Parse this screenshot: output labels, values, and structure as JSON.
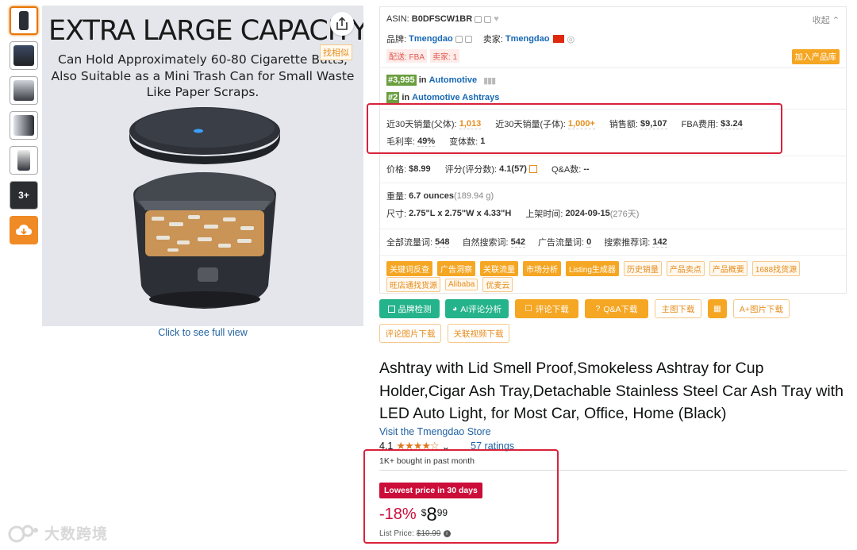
{
  "thumbnails": {
    "more_label": "3+"
  },
  "image": {
    "headline": "EXTRA LARGE CAPACITY",
    "subline_1": "Can Hold Approximately 60-80 Cigarette Butts,",
    "subline_2": "Also Suitable as a Mini Trash Can for Small Waste",
    "subline_3": "Like Paper Scraps.",
    "find_similar": "找相似",
    "click_full": "Click to see full view"
  },
  "watermark": {
    "text": "大数跨境"
  },
  "panel": {
    "asin_label": "ASIN:",
    "asin": "B0DFSCW1BR",
    "collapse": "收起",
    "brand_label": "品牌:",
    "brand": "Tmengdao",
    "seller_label": "卖家:",
    "seller": "Tmengdao",
    "tag_fba": "配送: FBA",
    "tag_seller": "卖家: 1",
    "add_library": "加入产品库",
    "rank1": "#3,995",
    "rank1_in": "in",
    "rank1_cat": "Automotive",
    "rank2": "#2",
    "rank2_in": "in",
    "rank2_cat": "Automotive Ashtrays",
    "sales30_parent_label": "近30天销量(父体):",
    "sales30_parent": "1,013",
    "sales30_child_label": "近30天销量(子体):",
    "sales30_child": "1,000+",
    "revenue_label": "销售额:",
    "revenue": "$9,107",
    "fba_label": "FBA费用:",
    "fba": "$3.24",
    "margin_label": "毛利率:",
    "margin": "49%",
    "variants_label": "变体数:",
    "variants": "1",
    "price_label": "价格:",
    "price": "$8.99",
    "score_label": "评分(评分数):",
    "score": "4.1(57)",
    "qa_label": "Q&A数:",
    "qa": "--",
    "weight_label": "重量:",
    "weight": "6.7 ounces",
    "weight_g": "(189.94 g)",
    "size_label": "尺寸:",
    "size": "2.75\"L x 2.75\"W x 4.33\"H",
    "listed_label": "上架时间:",
    "listed": "2024-09-15",
    "listed_days": "(276天)",
    "kw_all_label": "全部流量词:",
    "kw_all": "548",
    "kw_organic_label": "自然搜索词:",
    "kw_organic": "542",
    "kw_ad_label": "广告流量词:",
    "kw_ad": "0",
    "kw_rec_label": "搜索推荐词:",
    "kw_rec": "142",
    "chips_row1": [
      "关键词反查",
      "广告洞察",
      "关联流量",
      "市场分析",
      "Listing生成器",
      "历史销量",
      "产品卖点",
      "产品概要",
      "1688找货源"
    ],
    "chips_row2": [
      "旺店通找货源",
      "Alibaba",
      "优麦云"
    ]
  },
  "actions": {
    "brand_check": "品牌检测",
    "ai_review": "AI评论分析",
    "review_dl": "评论下载",
    "qa_dl": "Q&A下载",
    "main_img_dl": "主图下载",
    "a_plus_dl": "A+图片下载",
    "review_img_dl": "评论图片下载",
    "related_video_dl": "关联视频下载"
  },
  "product": {
    "title": "Ashtray with Lid Smell Proof,Smokeless Ashtray for Cup Holder,Cigar Ash Tray,Detachable Stainless Steel Car Ash Tray with LED Auto Light, for Most Car, Office, Home (Black)",
    "visit_store": "Visit the Tmengdao Store",
    "rating": "4.1",
    "stars": "★★★★☆",
    "ratings_count": "57 ratings",
    "bought": "1K+ bought in past month",
    "lowest_badge": "Lowest price in 30 days",
    "discount": "-18%",
    "currency": "$",
    "price_whole": "8",
    "price_frac": "99",
    "list_price_label": "List Price:",
    "list_price": "$10.99"
  }
}
